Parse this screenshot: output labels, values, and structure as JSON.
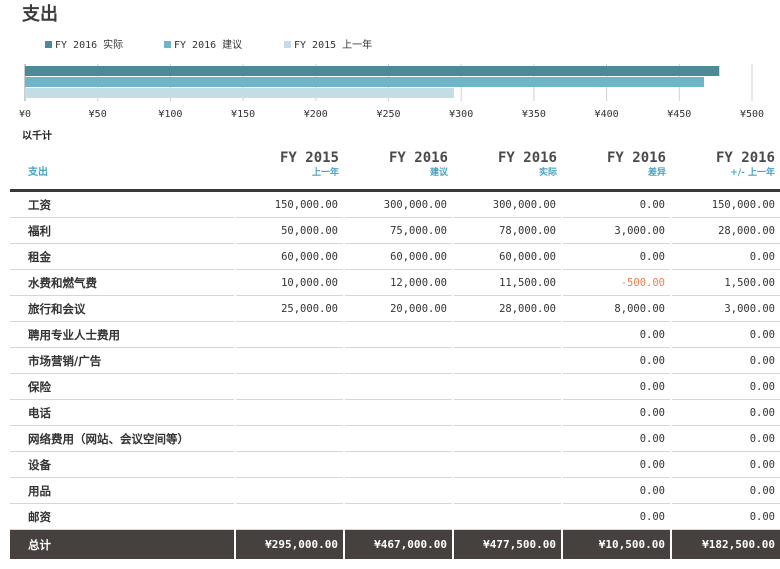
{
  "page_title": "支出",
  "unit_note": "以千计",
  "colors": {
    "actual": "#4b8a96",
    "budget": "#6fb5c7",
    "prev": "#c3dce6",
    "accent_text": "#4aa3c0",
    "negative": "#f07d4f",
    "total_bg": "#46413f"
  },
  "chart_data": {
    "type": "bar",
    "orientation": "horizontal",
    "series": [
      {
        "name": "FY 2016 实际",
        "values": [
          477500
        ]
      },
      {
        "name": "FY 2016 建议",
        "values": [
          467000
        ]
      },
      {
        "name": "FY 2015 上一年",
        "values": [
          295000
        ]
      }
    ],
    "xlim": [
      0,
      500
    ],
    "x_unit": "thousands",
    "x_ticks": [
      "¥0",
      "¥50",
      "¥100",
      "¥150",
      "¥200",
      "¥250",
      "¥300",
      "¥350",
      "¥400",
      "¥450",
      "¥500"
    ],
    "legend_position": "top-left",
    "grid": true
  },
  "table": {
    "header_label": "支出",
    "columns": [
      {
        "year": "FY 2015",
        "sub": "上一年"
      },
      {
        "year": "FY 2016",
        "sub": "建议"
      },
      {
        "year": "FY 2016",
        "sub": "实际"
      },
      {
        "year": "FY 2016",
        "sub": "差异"
      },
      {
        "year": "FY 2016",
        "sub": "+/- 上一年"
      }
    ],
    "rows": [
      {
        "label": "工资",
        "cells": [
          "150,000.00",
          "300,000.00",
          "300,000.00",
          "0.00",
          "150,000.00"
        ]
      },
      {
        "label": "福利",
        "cells": [
          "50,000.00",
          "75,000.00",
          "78,000.00",
          "3,000.00",
          "28,000.00"
        ]
      },
      {
        "label": "租金",
        "cells": [
          "60,000.00",
          "60,000.00",
          "60,000.00",
          "0.00",
          "0.00"
        ]
      },
      {
        "label": "水费和燃气费",
        "cells": [
          "10,000.00",
          "12,000.00",
          "11,500.00",
          "-500.00",
          "1,500.00"
        ]
      },
      {
        "label": "旅行和会议",
        "cells": [
          "25,000.00",
          "20,000.00",
          "28,000.00",
          "8,000.00",
          "3,000.00"
        ]
      },
      {
        "label": "聘用专业人士费用",
        "cells": [
          "",
          "",
          "",
          "0.00",
          "0.00"
        ]
      },
      {
        "label": "市场营销/广告",
        "cells": [
          "",
          "",
          "",
          "0.00",
          "0.00"
        ]
      },
      {
        "label": "保险",
        "cells": [
          "",
          "",
          "",
          "0.00",
          "0.00"
        ]
      },
      {
        "label": "电话",
        "cells": [
          "",
          "",
          "",
          "0.00",
          "0.00"
        ]
      },
      {
        "label": "网络费用（网站、会议空间等）",
        "cells": [
          "",
          "",
          "",
          "0.00",
          "0.00"
        ]
      },
      {
        "label": "设备",
        "cells": [
          "",
          "",
          "",
          "0.00",
          "0.00"
        ]
      },
      {
        "label": "用品",
        "cells": [
          "",
          "",
          "",
          "0.00",
          "0.00"
        ]
      },
      {
        "label": "邮资",
        "cells": [
          "",
          "",
          "",
          "0.00",
          "0.00"
        ]
      }
    ],
    "total": {
      "label": "总计",
      "cells": [
        "¥295,000.00",
        "¥467,000.00",
        "¥477,500.00",
        "¥10,500.00",
        "¥182,500.00"
      ]
    }
  }
}
